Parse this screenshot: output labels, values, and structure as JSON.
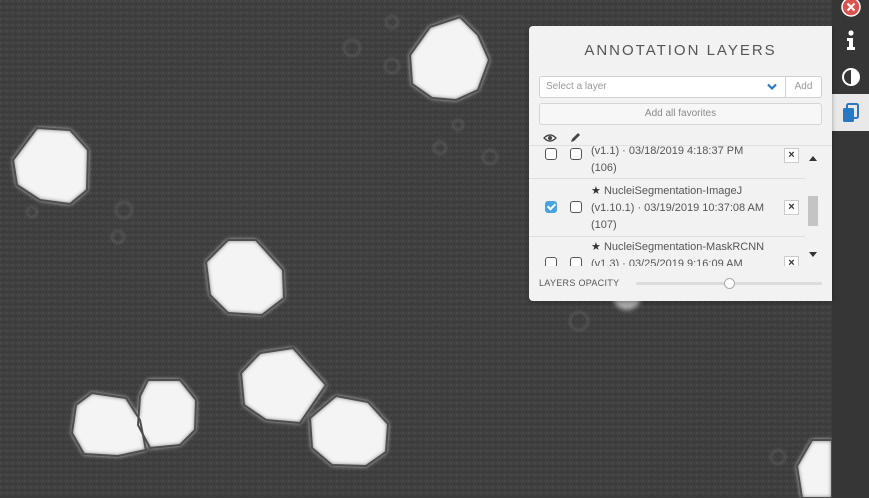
{
  "panel": {
    "title": "ANNOTATION LAYERS",
    "select_placeholder": "Select a layer",
    "add_label": "Add",
    "add_favorites_label": "Add all favorites",
    "layers_opacity_label": "LAYERS OPACITY",
    "layers_opacity_value": 0.5
  },
  "layers": [
    {
      "name": "",
      "meta": "(v1.1) · 03/18/2019 4:18:37 PM",
      "count": "(106)",
      "visible": false,
      "editable": false,
      "favorite": false
    },
    {
      "name": "NucleiSegmentation-ImageJ",
      "meta": "(v1.10.1) · 03/19/2019 10:37:08 AM",
      "count": "(107)",
      "visible": true,
      "editable": false,
      "favorite": true
    },
    {
      "name": "NucleiSegmentation-MaskRCNN",
      "meta": "(v1.3) · 03/25/2019 9:16:09 AM",
      "count": "",
      "visible": false,
      "editable": false,
      "favorite": true
    }
  ],
  "toolbar": {
    "buttons": [
      "close-icon",
      "info-icon",
      "contrast-icon",
      "layers-icon"
    ],
    "active": "layers-icon"
  },
  "icons": {
    "remove_glyph": "×",
    "star_glyph": "★"
  },
  "colors": {
    "accent": "#4aa3df",
    "close_button": "#d9534f",
    "layers_icon": "#2b78c2",
    "panel_background": "#f2f2f2"
  }
}
